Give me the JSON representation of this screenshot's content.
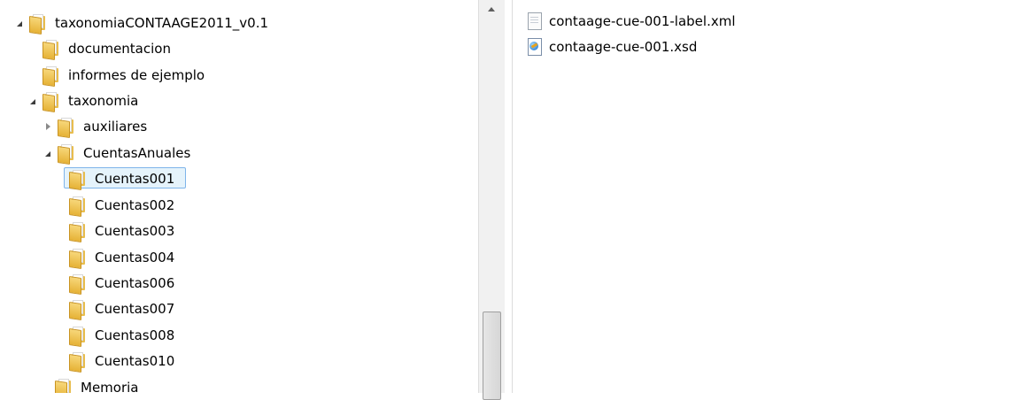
{
  "tree": {
    "items": [
      {
        "label": "taxonomiaCONTAAGE2011_v0.1",
        "arrow": "expanded"
      },
      {
        "label": "documentacion",
        "arrow": "none"
      },
      {
        "label": "informes de ejemplo",
        "arrow": "none"
      },
      {
        "label": "taxonomia",
        "arrow": "expanded"
      },
      {
        "label": "auxiliares",
        "arrow": "collapsed"
      },
      {
        "label": "CuentasAnuales",
        "arrow": "expanded"
      },
      {
        "label": "Cuentas001",
        "arrow": "none",
        "selected": true
      },
      {
        "label": "Cuentas002",
        "arrow": "none"
      },
      {
        "label": "Cuentas003",
        "arrow": "none"
      },
      {
        "label": "Cuentas004",
        "arrow": "none"
      },
      {
        "label": "Cuentas006",
        "arrow": "none"
      },
      {
        "label": "Cuentas007",
        "arrow": "none"
      },
      {
        "label": "Cuentas008",
        "arrow": "none"
      },
      {
        "label": "Cuentas010",
        "arrow": "none"
      },
      {
        "label": "Memoria",
        "arrow": "none"
      }
    ]
  },
  "files": {
    "items": [
      {
        "label": "contaage-cue-001-label.xml",
        "icon": "xml-file-icon"
      },
      {
        "label": "contaage-cue-001.xsd",
        "icon": "xsd-file-icon"
      }
    ]
  },
  "colors": {
    "selection_bg": "#e5f3fb",
    "selection_border": "#7eb4ea",
    "folder_yellow": "#e8bd4e"
  }
}
